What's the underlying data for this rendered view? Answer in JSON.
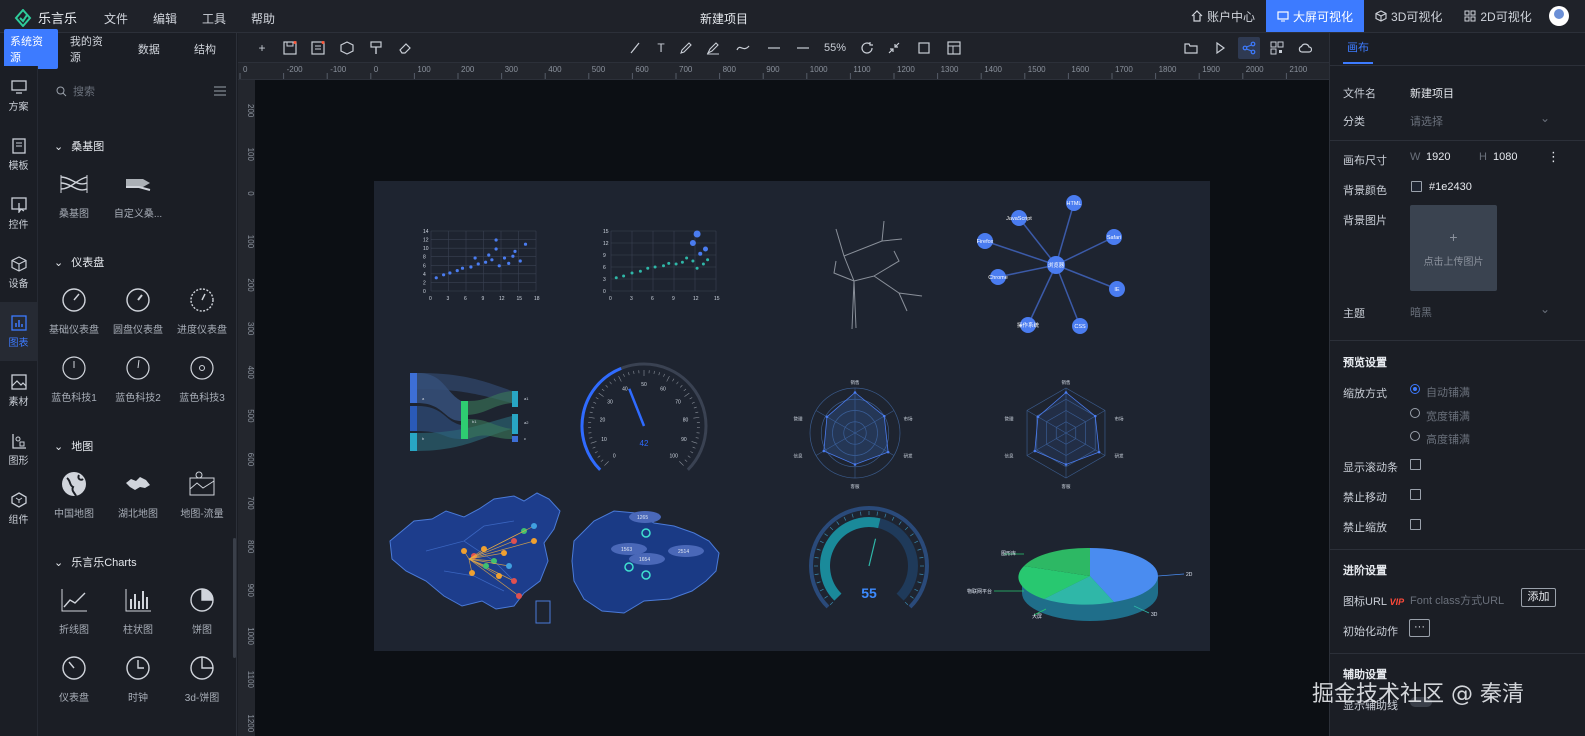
{
  "app": {
    "name": "乐言乐",
    "menu": [
      "文件",
      "编辑",
      "工具",
      "帮助"
    ],
    "doc_title": "新建项目"
  },
  "topnav": [
    {
      "label": "账户中心",
      "icon": "home-icon"
    },
    {
      "label": "大屏可视化",
      "icon": "monitor-icon",
      "active": true
    },
    {
      "label": "3D可视化",
      "icon": "cube-icon"
    },
    {
      "label": "2D可视化",
      "icon": "grid-icon"
    }
  ],
  "left_tabs": [
    "系统资源",
    "我的资源",
    "数据",
    "结构"
  ],
  "side_icons": [
    {
      "label": "方案",
      "icon": "monitor-icon"
    },
    {
      "label": "模板",
      "icon": "document-icon"
    },
    {
      "label": "控件",
      "icon": "pointer-icon"
    },
    {
      "label": "设备",
      "icon": "box-icon"
    },
    {
      "label": "图表",
      "icon": "bar-chart-icon",
      "active": true
    },
    {
      "label": "素材",
      "icon": "image-icon"
    },
    {
      "label": "图形",
      "icon": "shapes-icon"
    },
    {
      "label": "组件",
      "icon": "component-icon"
    }
  ],
  "search": {
    "placeholder": "搜索"
  },
  "sections": [
    {
      "title": "桑基图",
      "items": [
        "桑基图",
        "自定义桑..."
      ]
    },
    {
      "title": "仪表盘",
      "items": [
        "基础仪表盘",
        "圆盘仪表盘",
        "进度仪表盘",
        "蓝色科技1",
        "蓝色科技2",
        "蓝色科技3"
      ]
    },
    {
      "title": "地图",
      "items": [
        "中国地图",
        "湖北地图",
        "地图-流量"
      ]
    },
    {
      "title": "乐言乐Charts",
      "items": [
        "折线图",
        "柱状图",
        "饼图",
        "仪表盘",
        "时钟",
        "3d-饼图"
      ]
    }
  ],
  "toolbar": {
    "zoom": "55%"
  },
  "ruler": {
    "h_ticks": [
      "0",
      "-200",
      "-100",
      "0",
      "100",
      "200",
      "300",
      "400",
      "500",
      "600",
      "700",
      "800",
      "900",
      "1000",
      "1100",
      "1200",
      "1300",
      "1400",
      "1500",
      "1600",
      "1700",
      "1800",
      "1900",
      "2000",
      "2100"
    ],
    "v_ticks": [
      "200",
      "100",
      "0",
      "100",
      "200",
      "300",
      "400",
      "500",
      "600",
      "700",
      "800",
      "900",
      "1000",
      "1100",
      "1200"
    ]
  },
  "canvas": {
    "scatter1": {
      "yticks": [
        "14",
        "12",
        "10",
        "8",
        "6",
        "4",
        "2",
        "0"
      ],
      "xticks": [
        "0",
        "3",
        "6",
        "9",
        "12",
        "15",
        "18"
      ]
    },
    "scatter2": {
      "yticks": [
        "15",
        "12",
        "9",
        "6",
        "3",
        "0"
      ],
      "xticks": [
        "0",
        "3",
        "6",
        "9",
        "12",
        "15"
      ]
    },
    "graph_nodes": [
      "HTML",
      "JavaScript",
      "Firefox",
      "Safari",
      "浏览器",
      "Chrome",
      "IE",
      "操作系统",
      "CSS"
    ],
    "gauge1": {
      "ticks": [
        "0",
        "10",
        "20",
        "30",
        "40",
        "50",
        "60",
        "70",
        "80",
        "90",
        "100"
      ],
      "value": "42"
    },
    "radar1": {
      "labels": [
        "销售",
        "管理",
        "信息",
        "客服",
        "研发",
        "市场",
        "开发"
      ],
      "center": "文件"
    },
    "radar2": {
      "labels": [
        "销售",
        "管理",
        "信息",
        "客服",
        "研发",
        "市场",
        "开发"
      ],
      "center": "文件"
    },
    "hubei_values": [
      "1265",
      "1563",
      "1654",
      "2514"
    ],
    "gauge2": {
      "value": "55"
    },
    "pie3d": {
      "labels": [
        "图形库",
        "物联网平台",
        "大屏",
        "2D",
        "3D"
      ]
    },
    "sankey": {
      "labels": [
        "a",
        "b",
        "b1",
        "a1",
        "a2",
        "c"
      ]
    }
  },
  "right": {
    "tab": "画布",
    "file_name_label": "文件名",
    "file_name": "新建项目",
    "category_label": "分类",
    "category_placeholder": "请选择",
    "size_label": "画布尺寸",
    "w_label": "W",
    "w": "1920",
    "h_label": "H",
    "h": "1080",
    "bg_color_label": "背景颜色",
    "bg_color": "#1e2430",
    "bg_image_label": "背景图片",
    "upload_text": "点击上传图片",
    "theme_label": "主题",
    "theme_placeholder": "暗黑",
    "preview_title": "预览设置",
    "scale_label": "缩放方式",
    "scale_options": [
      "自动铺满",
      "宽度铺满",
      "高度铺满"
    ],
    "scrollbar_label": "显示滚动条",
    "no_move_label": "禁止移动",
    "no_zoom_label": "禁止缩放",
    "advanced_title": "进阶设置",
    "icon_url_label": "图标URL",
    "vip": "VIP",
    "icon_url_placeholder": "Font class方式URL",
    "add_btn": "添加",
    "init_action_label": "初始化动作",
    "assist_title": "辅助设置",
    "last_row": "显示辅助线"
  },
  "watermark": "掘金技术社区 @ 秦清"
}
